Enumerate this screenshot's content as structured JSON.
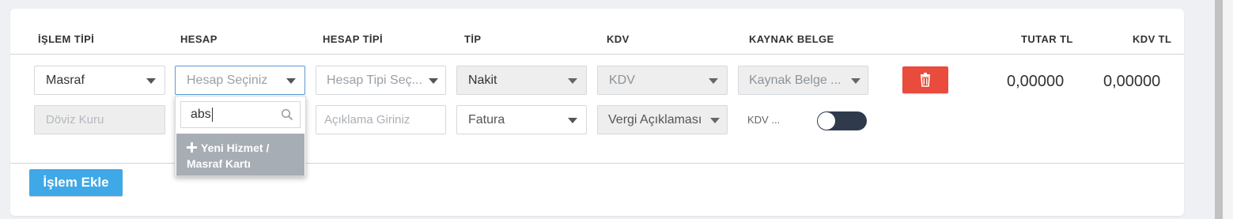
{
  "headers": {
    "islem_tipi": "İŞLEM TİPİ",
    "hesap": "HESAP",
    "hesap_tipi": "HESAP TİPİ",
    "tip": "TİP",
    "kdv": "KDV",
    "kaynak_belge": "KAYNAK BELGE",
    "tutar_tl": "TUTAR TL",
    "kdv_tl": "KDV TL"
  },
  "row1": {
    "islem_tipi_value": "Masraf",
    "hesap_placeholder": "Hesap Seçiniz",
    "hesap_tipi_placeholder": "Hesap Tipi Seç...",
    "tip_value": "Nakit",
    "kdv_placeholder": "KDV",
    "kaynak_belge_placeholder": "Kaynak Belge ...",
    "tutar_value": "0,00000",
    "kdv_tl_value": "0,00000"
  },
  "row2": {
    "doviz_kuru_placeholder": "Döviz Kuru",
    "aciklama_placeholder": "Açıklama Giriniz",
    "fatura_value": "Fatura",
    "vergi_aciklamasi_value": "Vergi Açıklaması",
    "kdv_toggle_label": "KDV ...",
    "kdv_toggle_on": false
  },
  "hesap_dropdown": {
    "search_value": "abs",
    "option_line1": "Yeni Hizmet /",
    "option_line2": "Masraf Kartı"
  },
  "actions": {
    "islem_ekle_label": "İşlem Ekle"
  },
  "icons": {
    "delete": "trash-icon",
    "search": "search-icon",
    "add": "plus-icon",
    "caret": "caret-down-icon"
  },
  "colors": {
    "delete_button": "#e94b3c",
    "primary_button": "#3fa8e6",
    "toggle_off": "#2f3b4c",
    "dropdown_option_bg": "#a7adb4"
  }
}
